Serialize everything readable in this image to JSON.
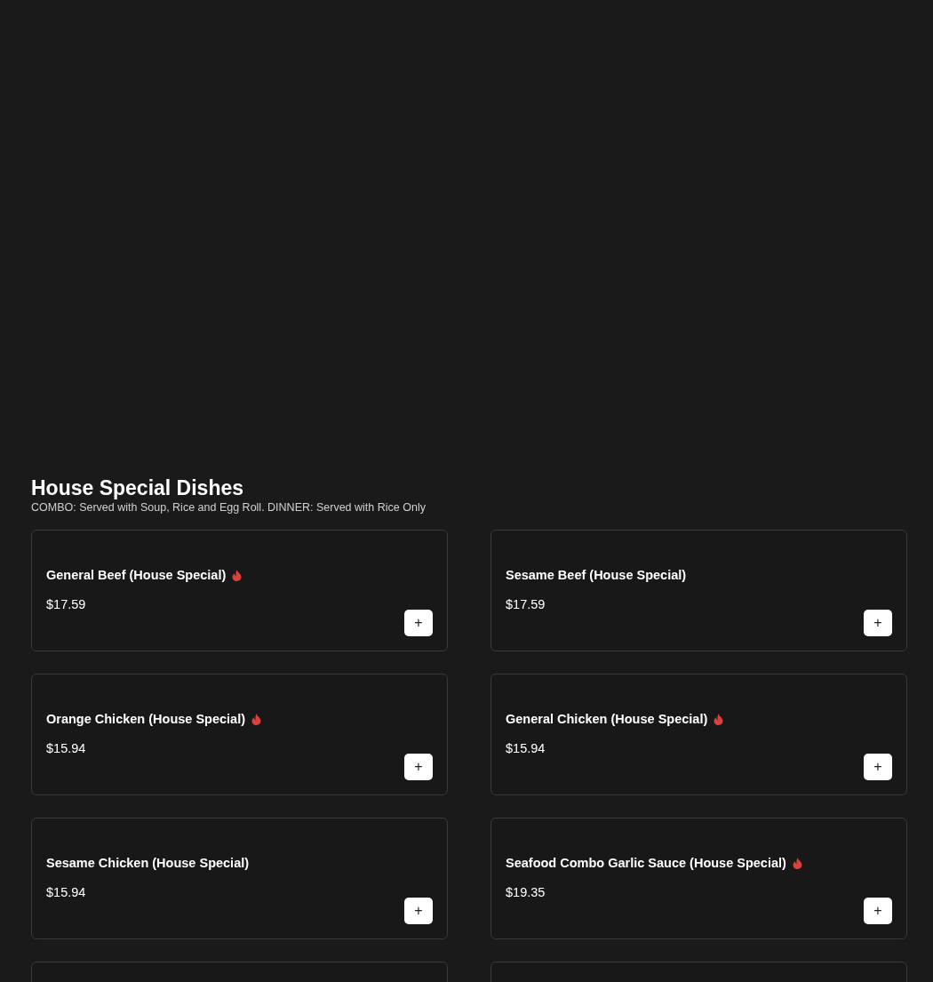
{
  "section": {
    "title": "House Special Dishes",
    "subtitle": "COMBO: Served with Soup, Rice and Egg Roll. DINNER: Served with Rice Only"
  },
  "items": [
    {
      "kind": "dish",
      "name": "General Beef (House Special)",
      "price": "$17.59",
      "spicy": true,
      "add_label": "+"
    },
    {
      "kind": "dish",
      "name": "Sesame Beef (House Special)",
      "price": "$17.59",
      "spicy": false,
      "add_label": "+"
    },
    {
      "kind": "dish",
      "name": "Orange Chicken (House Special)",
      "price": "$15.94",
      "spicy": true,
      "add_label": "+"
    },
    {
      "kind": "dish",
      "name": "General Chicken (House Special)",
      "price": "$15.94",
      "spicy": true,
      "add_label": "+"
    },
    {
      "kind": "dish",
      "name": "Sesame Chicken (House Special)",
      "price": "$15.94",
      "spicy": false,
      "add_label": "+"
    },
    {
      "kind": "dish",
      "name": "Seafood Combo Garlic Sauce (House Special)",
      "price": "$19.35",
      "spicy": true,
      "add_label": "+"
    },
    {
      "kind": "cut"
    },
    {
      "kind": "cut"
    }
  ]
}
